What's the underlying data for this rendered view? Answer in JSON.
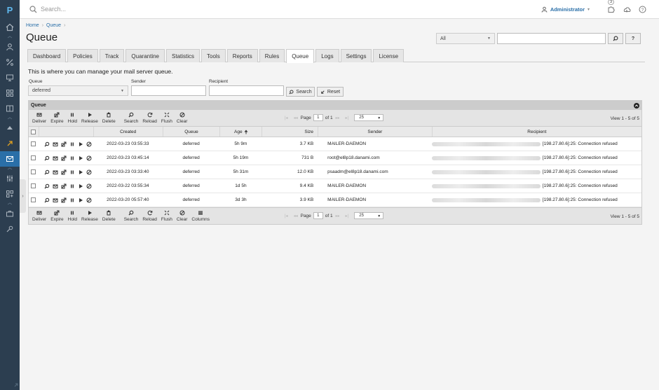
{
  "topbar": {
    "search_placeholder": "Search...",
    "user": "Administrator",
    "notification_count": "3"
  },
  "breadcrumb": [
    "Home",
    "Queue"
  ],
  "page_title": "Queue",
  "top_filter": {
    "select_value": "All",
    "search_btn": "🔎",
    "help_btn": "?"
  },
  "tabs": [
    "Dashboard",
    "Policies",
    "Track",
    "Quarantine",
    "Statistics",
    "Tools",
    "Reports",
    "Rules",
    "Queue",
    "Logs",
    "Settings",
    "License"
  ],
  "active_tab": "Queue",
  "intro": "This is where you can manage your mail server queue.",
  "filters": {
    "queue_label": "Queue",
    "queue_value": "deferred",
    "sender_label": "Sender",
    "recipient_label": "Recipient",
    "search_label": "Search",
    "reset_label": "Reset"
  },
  "grid": {
    "title": "Queue",
    "toolbar": [
      "Deliver",
      "Expire",
      "Hold",
      "Release",
      "Delete",
      "Search",
      "Reload",
      "Flush",
      "Clear"
    ],
    "toolbar_bottom": [
      "Deliver",
      "Expire",
      "Hold",
      "Release",
      "Delete",
      "Search",
      "Reload",
      "Flush",
      "Clear",
      "Columns"
    ],
    "pager": {
      "page_label": "Page",
      "page": "1",
      "of": "of 1",
      "page_size": "25"
    },
    "view_info": "View 1 - 5 of 5",
    "columns": {
      "created": "Created",
      "queue": "Queue",
      "age": "Age",
      "size": "Size",
      "sender": "Sender",
      "recipient": "Recipient"
    },
    "rows": [
      {
        "created": "2022-03-23 03:55:33",
        "queue": "deferred",
        "age": "5h 9m",
        "size": "3.7 KB",
        "sender": "MAILER-DAEMON",
        "recipient": "[198.27.80.6]:25: Connection refused"
      },
      {
        "created": "2022-03-23 03:45:14",
        "queue": "deferred",
        "age": "5h 19m",
        "size": "731 B",
        "sender": "root@el8p18.danami.com",
        "recipient": "[198.27.80.6]:25: Connection refused"
      },
      {
        "created": "2022-03-23 03:33:40",
        "queue": "deferred",
        "age": "5h 31m",
        "size": "12.0 KB",
        "sender": "psaadm@el8p18.danami.com",
        "recipient": "[198.27.80.6]:25: Connection refused"
      },
      {
        "created": "2022-03-22 03:55:34",
        "queue": "deferred",
        "age": "1d 5h",
        "size": "9.4 KB",
        "sender": "MAILER-DAEMON",
        "recipient": "[198.27.80.6]:25: Connection refused"
      },
      {
        "created": "2022-03-20 05:57:40",
        "queue": "deferred",
        "age": "3d 3h",
        "size": "3.9 KB",
        "sender": "MAILER-DAEMON",
        "recipient": "[198.27.80.6]:25: Connection refused"
      }
    ]
  },
  "colors": {
    "sidebar": "#2c3e50",
    "accent": "#2a6fa8",
    "active_nav": "#2a6fa8"
  }
}
